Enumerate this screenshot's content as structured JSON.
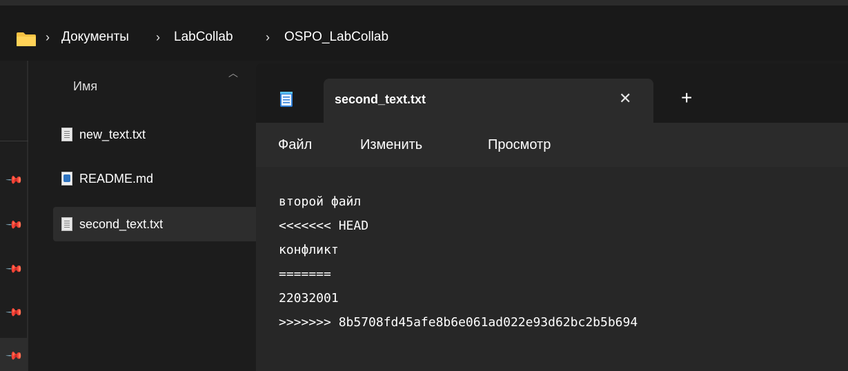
{
  "breadcrumb": {
    "items": [
      "Документы",
      "LabCollab",
      "OSPO_LabCollab"
    ],
    "separator": "›"
  },
  "file_list": {
    "column_header": "Имя",
    "files": [
      {
        "name": "new_text.txt",
        "icon": "text-file-icon"
      },
      {
        "name": "README.md",
        "icon": "markdown-file-icon"
      },
      {
        "name": "second_text.txt",
        "icon": "text-file-icon",
        "selected": true
      }
    ]
  },
  "notepad": {
    "tab_title": "second_text.txt",
    "close_glyph": "✕",
    "new_tab_glyph": "+",
    "menu": [
      "Файл",
      "Изменить",
      "Просмотр"
    ],
    "lines": [
      "второй файл",
      "<<<<<<< HEAD",
      "конфликт",
      "=======",
      "22032001",
      ">>>>>>> 8b5708fd45afe8b6e061ad022e93d62bc2b5b694"
    ]
  },
  "colors": {
    "folder": "#f6c142",
    "selected_row": "#2d2d2d",
    "notepad_icon": "#2f7fd8"
  }
}
